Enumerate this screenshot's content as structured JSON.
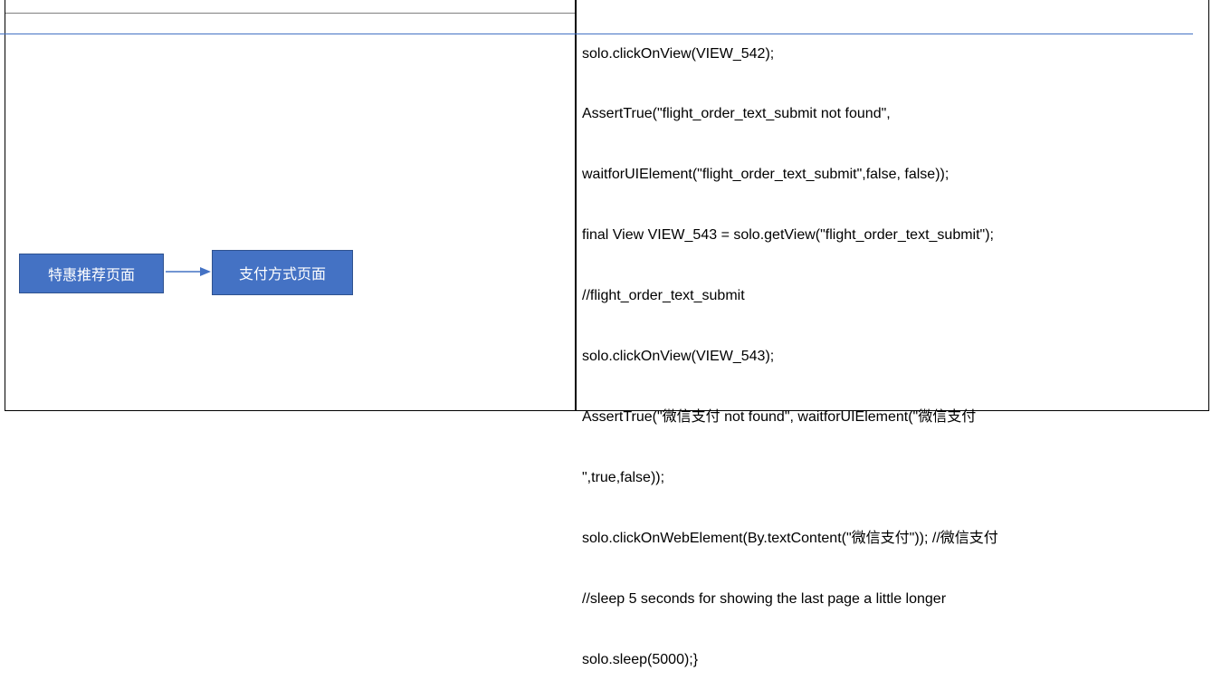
{
  "left_cell": {
    "flow": {
      "step1_label": "特惠推荐页面",
      "step2_label": "支付方式页面"
    }
  },
  "right_cell": {
    "code_lines": [
      "solo.clickOnView(VIEW_542);",
      "AssertTrue(\"flight_order_text_submit not found\",",
      "waitforUIElement(\"flight_order_text_submit\",false, false));",
      "final View VIEW_543 = solo.getView(\"flight_order_text_submit\");",
      "//flight_order_text_submit",
      "solo.clickOnView(VIEW_543);",
      "AssertTrue(\"微信支付 not found\", waitforUIElement(\"微信支付",
      "\",true,false));",
      "solo.clickOnWebElement(By.textContent(\"微信支付\")); //微信支付",
      "//sleep 5 seconds for showing the last page a little longer",
      "solo.sleep(5000);}"
    ]
  },
  "colors": {
    "box_fill": "#4472c4",
    "box_border": "#2f528f",
    "rule_blue": "#4472c4"
  }
}
